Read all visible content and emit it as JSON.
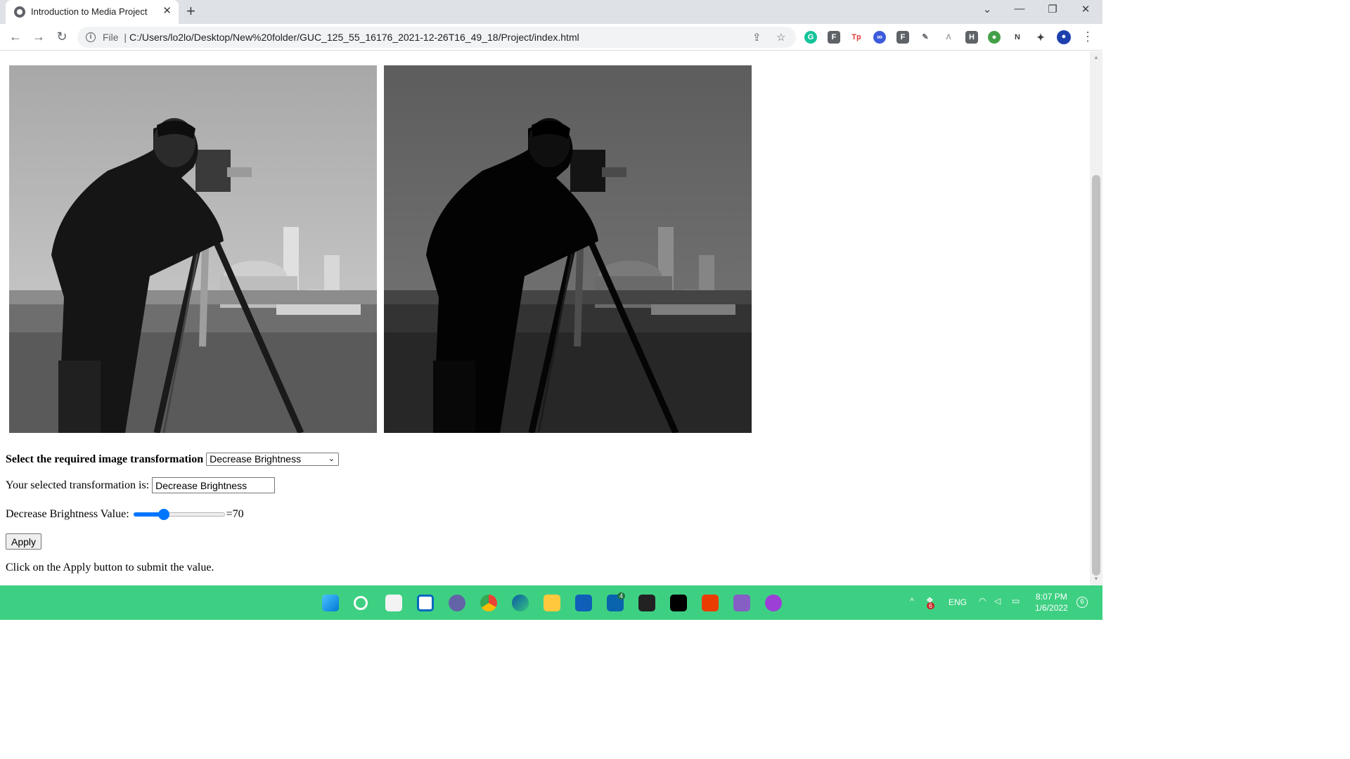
{
  "browser": {
    "tab_title": "Introduction to Media Project",
    "scheme_label": "File",
    "url": "C:/Users/lo2lo/Desktop/New%20folder/GUC_125_55_16176_2021-12-26T16_49_18/Project/index.html"
  },
  "page": {
    "select_label": "Select the required image transformation",
    "selected_option": "Decrease Brightness",
    "selected_label": "Your selected transformation is:",
    "selected_value": "Decrease Brightness",
    "slider_label": "Decrease Brightness Value:",
    "slider_value_text": "=70",
    "slider_fraction": 0.31,
    "apply_label": "Apply",
    "hint": "Click on the Apply button to submit the value."
  },
  "images": {
    "original_brightness": 1.0,
    "processed_brightness": 0.55
  },
  "taskbar": {
    "language": "ENG",
    "time": "8:07 PM",
    "date": "1/6/2022",
    "notifications": "6",
    "mail_badge": "4",
    "tray_badge": "6"
  },
  "colors": {
    "accent": "#0075ff",
    "taskbar": "#3ed082",
    "tabstrip": "#dee1e6"
  },
  "icons": {
    "taskbar_apps": [
      "start-icon",
      "search-icon",
      "task-view-icon",
      "widgets-icon",
      "teams-chat-icon",
      "chrome-icon",
      "edge-icon",
      "file-explorer-icon",
      "store-icon",
      "mail-icon",
      "notion-icon",
      "netflix-icon",
      "office-icon",
      "visual-studio-icon",
      "podcast-icon"
    ]
  }
}
